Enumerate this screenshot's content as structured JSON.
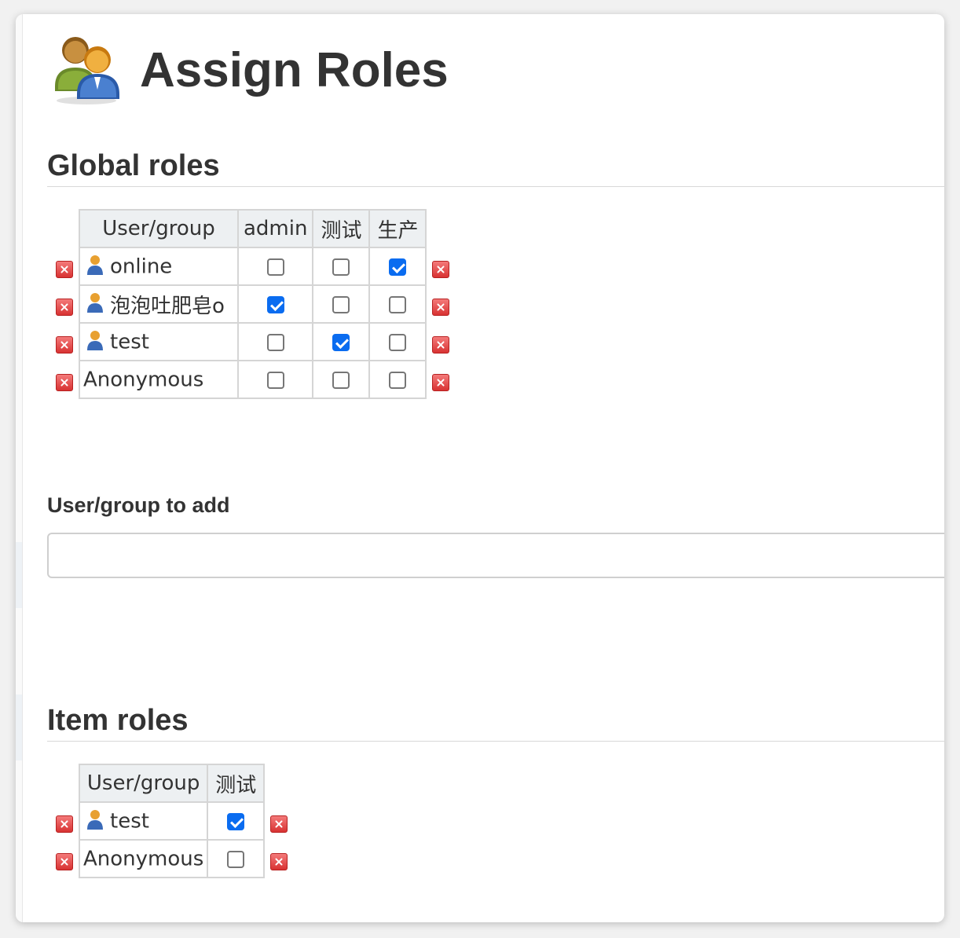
{
  "page": {
    "title": "Assign Roles"
  },
  "global_roles": {
    "section_title": "Global roles",
    "header_user": "User/group",
    "columns": [
      "admin",
      "测试",
      "生产"
    ],
    "rows": [
      {
        "name": "online",
        "type": "user",
        "checks": [
          false,
          false,
          true
        ]
      },
      {
        "name": "泡泡吐肥皂o",
        "type": "user",
        "checks": [
          true,
          false,
          false
        ]
      },
      {
        "name": "test",
        "type": "user",
        "checks": [
          false,
          true,
          false
        ]
      },
      {
        "name": "Anonymous",
        "type": "anonymous",
        "checks": [
          false,
          false,
          false
        ]
      }
    ]
  },
  "add_user": {
    "label": "User/group to add",
    "value": "",
    "placeholder": ""
  },
  "item_roles": {
    "section_title": "Item roles",
    "header_user": "User/group",
    "columns": [
      "测试"
    ],
    "rows": [
      {
        "name": "test",
        "type": "user",
        "checks": [
          true
        ]
      },
      {
        "name": "Anonymous",
        "type": "anonymous",
        "checks": [
          false
        ]
      }
    ]
  },
  "icons": {
    "header": "roles-people-icon",
    "user": "user-icon",
    "delete": "delete-icon"
  },
  "colors": {
    "checkbox_checked": "#0a6cf0",
    "delete": "#d83232",
    "header_bg": "#edf0f2"
  }
}
